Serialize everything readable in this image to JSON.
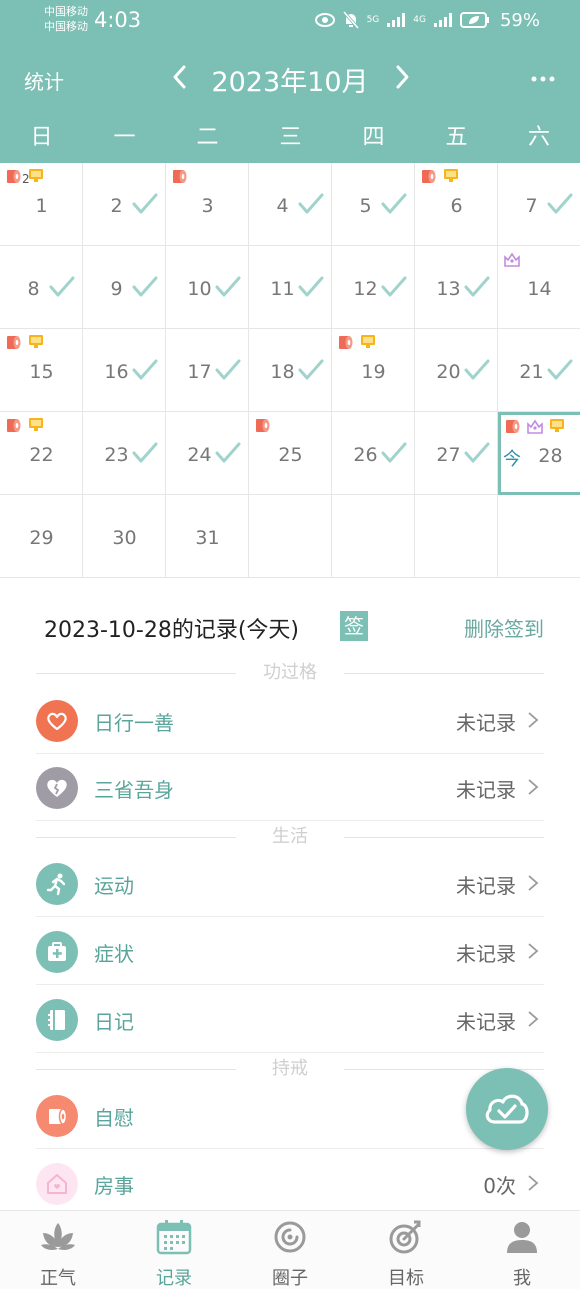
{
  "status_bar": {
    "carrier_1": "中国移动",
    "carrier_2": "中国移动",
    "time": "4:03",
    "signal_1": "5G",
    "signal_2": "4G",
    "battery": "59%"
  },
  "header": {
    "stats_label": "统计",
    "month_title": "2023年10月",
    "more_label": "···"
  },
  "weekdays": [
    "日",
    "一",
    "二",
    "三",
    "四",
    "五",
    "六"
  ],
  "calendar": {
    "today_label": "今",
    "days": [
      {
        "day": "1",
        "marks": [
          "roll",
          "screen"
        ],
        "count": "2",
        "check": false
      },
      {
        "day": "2",
        "marks": [],
        "check": true
      },
      {
        "day": "3",
        "marks": [
          "roll"
        ],
        "check": false
      },
      {
        "day": "4",
        "marks": [],
        "check": true
      },
      {
        "day": "5",
        "marks": [],
        "check": true
      },
      {
        "day": "6",
        "marks": [
          "roll",
          "screen"
        ],
        "check": false
      },
      {
        "day": "7",
        "marks": [],
        "check": true
      },
      {
        "day": "8",
        "marks": [],
        "check": true
      },
      {
        "day": "9",
        "marks": [],
        "check": true
      },
      {
        "day": "10",
        "marks": [],
        "check": true
      },
      {
        "day": "11",
        "marks": [],
        "check": true
      },
      {
        "day": "12",
        "marks": [],
        "check": true
      },
      {
        "day": "13",
        "marks": [],
        "check": true
      },
      {
        "day": "14",
        "marks": [
          "pose"
        ],
        "check": false
      },
      {
        "day": "15",
        "marks": [
          "roll",
          "screen"
        ],
        "check": false
      },
      {
        "day": "16",
        "marks": [],
        "check": true
      },
      {
        "day": "17",
        "marks": [],
        "check": true
      },
      {
        "day": "18",
        "marks": [],
        "check": true
      },
      {
        "day": "19",
        "marks": [
          "roll",
          "screen"
        ],
        "check": false
      },
      {
        "day": "20",
        "marks": [],
        "check": true
      },
      {
        "day": "21",
        "marks": [],
        "check": true
      },
      {
        "day": "22",
        "marks": [
          "roll",
          "screen"
        ],
        "check": false
      },
      {
        "day": "23",
        "marks": [],
        "check": true
      },
      {
        "day": "24",
        "marks": [],
        "check": true
      },
      {
        "day": "25",
        "marks": [
          "roll"
        ],
        "check": false
      },
      {
        "day": "26",
        "marks": [],
        "check": true
      },
      {
        "day": "27",
        "marks": [],
        "check": true
      },
      {
        "day": "28",
        "marks": [
          "roll",
          "pose",
          "screen"
        ],
        "check": false,
        "today": true
      },
      {
        "day": "29",
        "marks": [],
        "check": false
      },
      {
        "day": "30",
        "marks": [],
        "check": false
      },
      {
        "day": "31",
        "marks": [],
        "check": false
      }
    ]
  },
  "record": {
    "title": "2023-10-28的记录(今天)",
    "sign_badge": "签",
    "delete_label": "删除签到"
  },
  "sections": [
    {
      "label": "功过格",
      "items": [
        {
          "name": "日行一善",
          "status": "未记录",
          "color": "#f07452",
          "icon": "heart-icon"
        },
        {
          "name": "三省吾身",
          "status": "未记录",
          "color": "#a09ca6",
          "icon": "broken-heart-icon"
        }
      ]
    },
    {
      "label": "生活",
      "items": [
        {
          "name": "运动",
          "status": "未记录",
          "color": "#7cbfb4",
          "icon": "running-icon"
        },
        {
          "name": "症状",
          "status": "未记录",
          "color": "#7cbfb4",
          "icon": "medical-kit-icon"
        },
        {
          "name": "日记",
          "status": "未记录",
          "color": "#7cbfb4",
          "icon": "notebook-icon"
        }
      ]
    },
    {
      "label": "持戒",
      "items": [
        {
          "name": "自慰",
          "status": "",
          "color": "#f58a70",
          "icon": "tissue-roll-icon"
        },
        {
          "name": "房事",
          "status": "0次",
          "color": "#fbd4e8",
          "icon": "house-icon"
        }
      ]
    }
  ],
  "bottom_nav": [
    {
      "label": "正气",
      "icon": "lotus-icon",
      "active": false
    },
    {
      "label": "记录",
      "icon": "calendar-icon",
      "active": true
    },
    {
      "label": "圈子",
      "icon": "circle-icon",
      "active": false
    },
    {
      "label": "目标",
      "icon": "target-icon",
      "active": false
    },
    {
      "label": "我",
      "icon": "person-icon",
      "active": false
    }
  ],
  "colors": {
    "accent": "#7cbfb4",
    "check": "#9fd3cc",
    "roll": "#f06b55",
    "screen": "#f7b51b",
    "pose": "#c48be0"
  }
}
